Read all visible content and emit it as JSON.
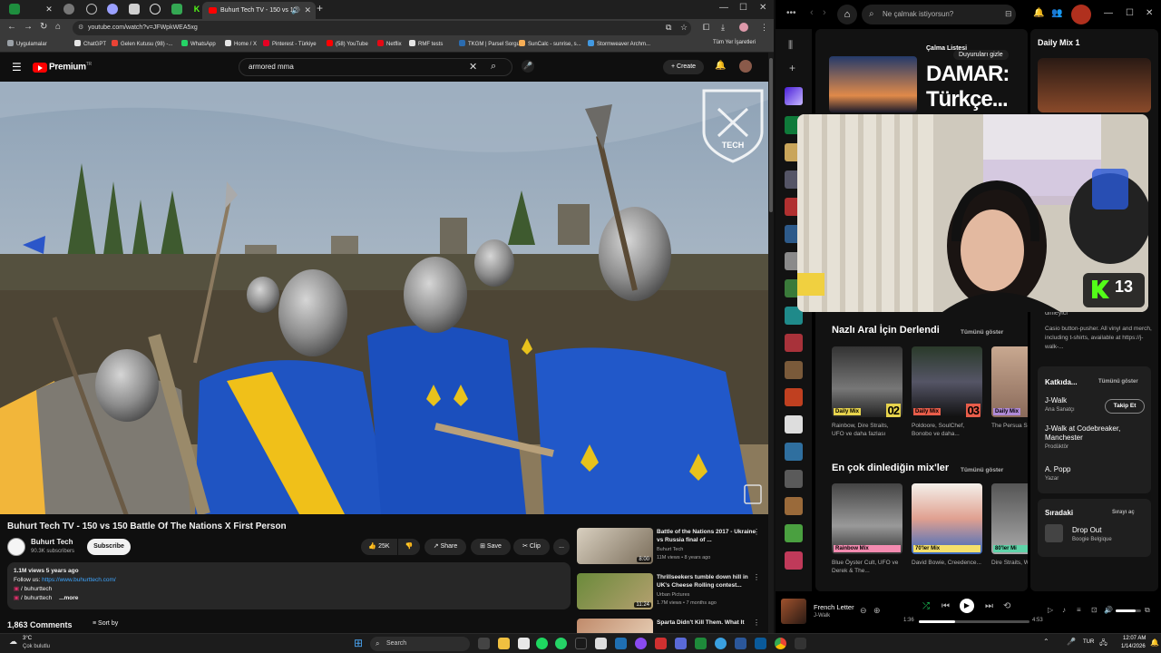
{
  "browser": {
    "active_tab_title": "Buhurt Tech TV - 150 vs 15",
    "new_tab_label": "+",
    "url": "youtube.com/watch?v=JFWpkWEA5xg",
    "bookmarks": [
      {
        "label": "Uygulamalar",
        "color": "#9aa0a6"
      },
      {
        "label": "ChatGPT",
        "color": "#e5e5e5"
      },
      {
        "label": "Gelen Kutusu (98) -...",
        "color": "#ea4335"
      },
      {
        "label": "WhatsApp",
        "color": "#25d366"
      },
      {
        "label": "Home / X",
        "color": "#e5e5e5"
      },
      {
        "label": "Pinterest - Türkiye",
        "color": "#e60023"
      },
      {
        "label": "(58) YouTube",
        "color": "#ff0000"
      },
      {
        "label": "Netflix",
        "color": "#e50914"
      },
      {
        "label": "RMF tests",
        "color": "#e5e5e5"
      },
      {
        "label": "TKGM | Parsel Sorgu...",
        "color": "#2b6cb0"
      },
      {
        "label": "SunCalc - sunrise, s...",
        "color": "#f6ad55"
      },
      {
        "label": "Stormweaver Archm...",
        "color": "#4299e1"
      }
    ],
    "all_bookmarks_label": "Tüm Yer İşaretleri"
  },
  "youtube": {
    "brand": "Premium",
    "brand_region": "TR",
    "search_query": "armored mma",
    "create_label": "Create",
    "video_title": "Buhurt Tech TV - 150 vs 150 Battle Of The Nations X First Person",
    "watermark": "TECH",
    "channel": {
      "name": "Buhurt Tech",
      "subscribers": "90.3K subscribers",
      "subscribe_label": "Subscribe"
    },
    "actions": {
      "likes": "25K",
      "share": "Share",
      "save": "Save",
      "clip": "Clip",
      "more": "..."
    },
    "description": {
      "meta": "1.1M views  5 years ago",
      "follow_prefix": "Follow us:",
      "follow_link": "https://www.buhurttech.com/",
      "line1": "/ buhurttech",
      "line2": "/ buhurttech",
      "more": "...more"
    },
    "comments_count": "1,863 Comments",
    "sort_label": "Sort by",
    "recommendations": [
      {
        "title": "Battle of the Nations 2017 - Ukraine vs Russia final of ...",
        "channel": "Buhurt Tech",
        "meta": "11M views • 8 years ago",
        "duration": "8:00"
      },
      {
        "title": "Thrillseekers tumble down hill in UK's Cheese Rolling contest...",
        "channel": "Urban Pictures",
        "meta": "1.7M views • 7 months ago",
        "duration": "11:24"
      },
      {
        "title": "Sparta Didn't Kill Them. What It",
        "channel": "",
        "meta": "",
        "duration": ""
      }
    ]
  },
  "spotify": {
    "search_placeholder": "Ne çalmak istiyorsun?",
    "featured": {
      "label": "Çalma Listesi",
      "title_line1": "DAMAR:",
      "title_line2": "Türkçe...",
      "hide_label": "Duyuruları gizle"
    },
    "section1": {
      "title": "Nazlı Aral İçin Derlendi",
      "show_all": "Tümünü göster",
      "cards": [
        {
          "badge": "Daily Mix",
          "num": "02",
          "desc": "Rainbow, Dire Straits, UFO ve daha fazlası",
          "color": "#e8d44d"
        },
        {
          "badge": "Daily Mix",
          "num": "03",
          "desc": "Poldoore, SoulChef, Bonobo ve daha...",
          "color": "#e85d4a"
        },
        {
          "badge": "Daily Mix",
          "num": "",
          "desc": "The Persua Shivaree",
          "color": "#b08ad8"
        }
      ]
    },
    "section2": {
      "title": "En çok dinlediğin mix'ler",
      "show_all": "Tümünü göster",
      "cards": [
        {
          "badge": "Rainbow Mix",
          "desc": "Blue Öyster Cult, UFO ve Derek & The...",
          "color": "#f48bb0"
        },
        {
          "badge": "70'ler Mix",
          "desc": "David Bowie, Creedence...",
          "color": "#f4e06b"
        },
        {
          "badge": "80'ler Mi",
          "desc": "Dire Straits, Whitesnake",
          "color": "#5fd3a8"
        }
      ]
    },
    "right_panel": {
      "title": "Daily Mix 1",
      "artist_label": "dinleyici",
      "bio": "Casio button-pusher. All vinyl and merch, including t-shirts, available at https://j-walk-...",
      "credits_title": "Katkıda...",
      "credits_show_all": "Tümünü göster",
      "credits": [
        {
          "name": "J-Walk",
          "role": "Ana Sanatçı",
          "follow": "Takip Et"
        },
        {
          "name": "J-Walk at Codebreaker, Manchester",
          "role": "Prodüktör",
          "follow": ""
        },
        {
          "name": "A. Popp",
          "role": "Yazar",
          "follow": ""
        }
      ],
      "queue_title": "Sıradaki",
      "queue_open": "Sırayı aç",
      "queue_track": "Drop Out",
      "queue_artist": "Boogie Belgique"
    },
    "webcam_badge": "13",
    "player": {
      "track": "French Letter",
      "artist": "J-Walk",
      "elapsed": "1:36",
      "total": "4:53",
      "progress": 0.33,
      "volume": 0.8
    }
  },
  "taskbar": {
    "weather_temp": "3°C",
    "weather_desc": "Çok bulutlu",
    "search_label": "Search",
    "lang": "TUR",
    "time": "12:07 AM",
    "date": "1/14/2026"
  }
}
